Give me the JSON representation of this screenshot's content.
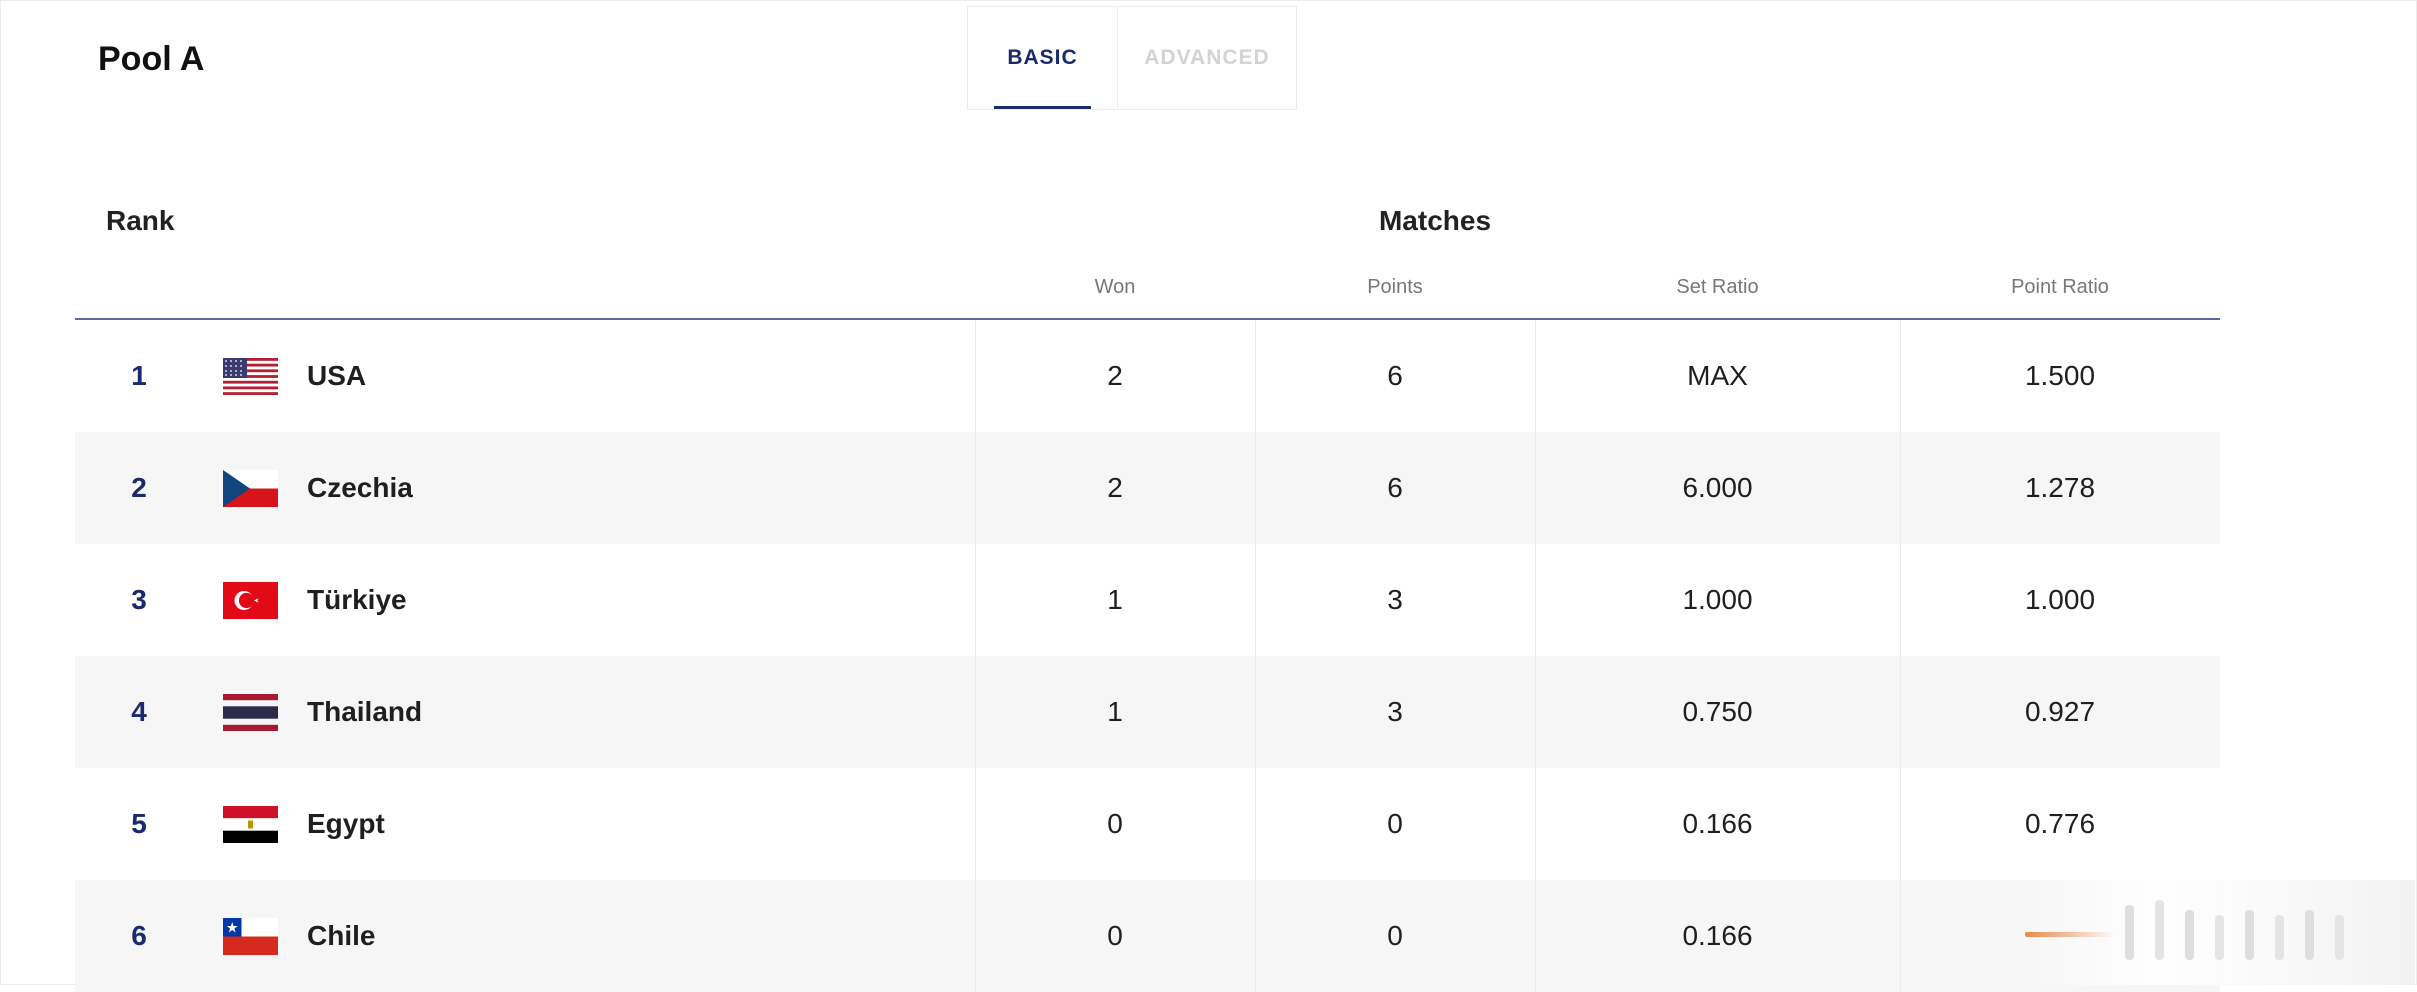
{
  "pool": {
    "title": "Pool A"
  },
  "tabs": [
    {
      "label": "BASIC",
      "active": true
    },
    {
      "label": "ADVANCED",
      "active": false
    }
  ],
  "table": {
    "rank_header": "Rank",
    "group_header": "Matches",
    "columns": [
      "Won",
      "Points",
      "Set Ratio",
      "Point Ratio"
    ],
    "rows": [
      {
        "rank": "1",
        "team": "USA",
        "flag": "usa-flag-icon",
        "won": "2",
        "points": "6",
        "set_ratio": "MAX",
        "point_ratio": "1.500"
      },
      {
        "rank": "2",
        "team": "Czechia",
        "flag": "czechia-flag-icon",
        "won": "2",
        "points": "6",
        "set_ratio": "6.000",
        "point_ratio": "1.278"
      },
      {
        "rank": "3",
        "team": "Türkiye",
        "flag": "turkiye-flag-icon",
        "won": "1",
        "points": "3",
        "set_ratio": "1.000",
        "point_ratio": "1.000"
      },
      {
        "rank": "4",
        "team": "Thailand",
        "flag": "thailand-flag-icon",
        "won": "1",
        "points": "3",
        "set_ratio": "0.750",
        "point_ratio": "0.927"
      },
      {
        "rank": "5",
        "team": "Egypt",
        "flag": "egypt-flag-icon",
        "won": "0",
        "points": "0",
        "set_ratio": "0.166",
        "point_ratio": "0.776"
      },
      {
        "rank": "6",
        "team": "Chile",
        "flag": "chile-flag-icon",
        "won": "0",
        "points": "0",
        "set_ratio": "0.166",
        "point_ratio": ""
      }
    ]
  },
  "colors": {
    "accent": "#1a2a6c",
    "row_alt": "#f6f6f6",
    "header_line": "#5a6c9f",
    "inactive_tab": "#d3d3d3"
  }
}
